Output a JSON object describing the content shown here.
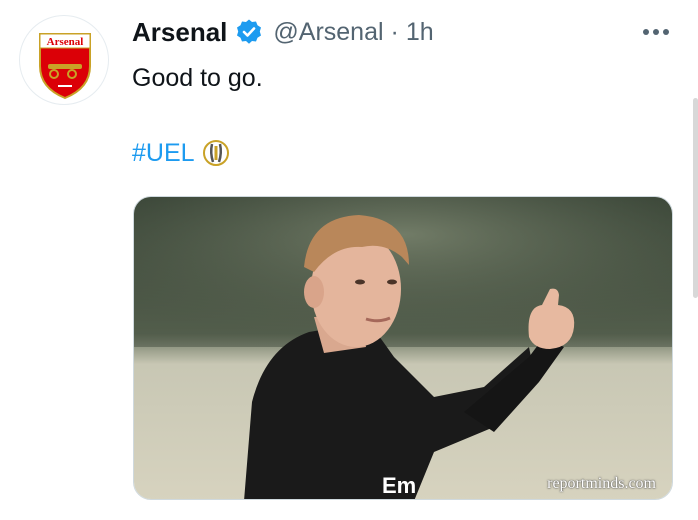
{
  "tweet": {
    "author_name": "Arsenal",
    "handle": "@Arsenal",
    "separator": "·",
    "time": "1h",
    "text": "Good to go.",
    "hashtag": "#UEL",
    "more_label": "•••"
  },
  "avatar": {
    "crest_text": "Arsenal",
    "icon": "arsenal-crest-icon"
  },
  "media": {
    "description_icon": "player-thumbs-up-photo",
    "watermark": "reportminds.com",
    "shirt_text": "Em"
  },
  "colors": {
    "link": "#1d9bf0",
    "secondary_text": "#536471",
    "primary_text": "#0f1419",
    "verified": "#1d9bf0",
    "crest_red": "#db0007",
    "crest_gold": "#c9a227"
  }
}
